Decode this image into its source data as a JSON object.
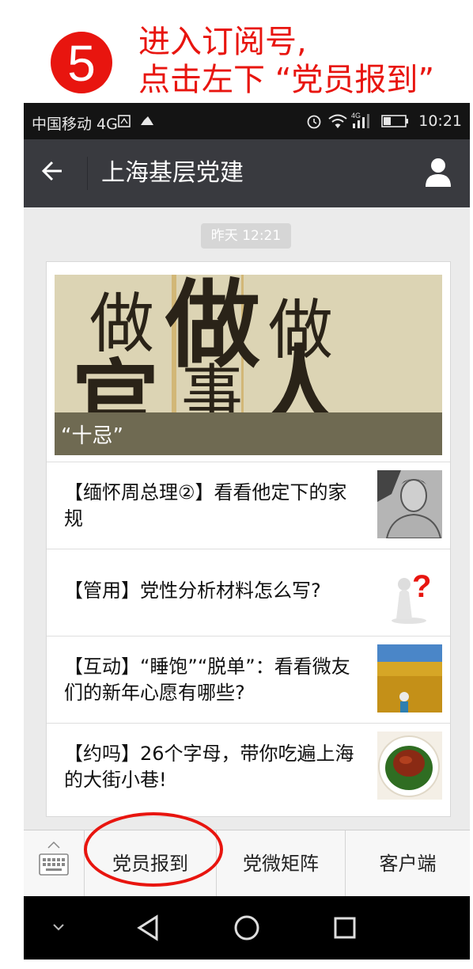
{
  "instruction": {
    "step_number": "5",
    "line1": "进入订阅号,",
    "line2": "点击左下 “党员报到”",
    "color": "#e8150f"
  },
  "status_bar": {
    "carrier": "中国移动 4G",
    "network": "4G",
    "time": "10:21",
    "icons": [
      "sim-icon",
      "cloud-icon",
      "alarm-icon",
      "wifi-icon",
      "signal-icon",
      "battery-icon"
    ]
  },
  "title_bar": {
    "title": "上海基层党建",
    "back_icon": "back-arrow-icon",
    "profile_icon": "person-icon",
    "background": "#393a3f"
  },
  "chat": {
    "timestamp": "昨天 12:21",
    "cover": {
      "headline_chars": [
        "做",
        "官",
        "做",
        "事",
        "做",
        "人"
      ],
      "caption": "“十忌”"
    },
    "articles": [
      {
        "title": "【缅怀周总理②】看看他定下的家规",
        "thumb": "portrait-photo"
      },
      {
        "title": "【管用】党性分析材料怎么写?",
        "thumb": "question-mark-figure"
      },
      {
        "title": "【互动】“睡饱”“脱单”：看看微友们的新年心愿有哪些?",
        "thumb": "wheat-field-photo"
      },
      {
        "title": "【约吗】26个字母，带你吃遍上海的大街小巷!",
        "thumb": "food-plate-photo"
      }
    ]
  },
  "menu": {
    "items": [
      "党员报到",
      "党微矩阵",
      "客户端"
    ],
    "keyboard_icon": "keyboard-icon",
    "highlighted": "党员报到"
  },
  "nav": {
    "buttons": [
      "hide-icon",
      "back-triangle-icon",
      "home-circle-icon",
      "recents-square-icon"
    ]
  }
}
